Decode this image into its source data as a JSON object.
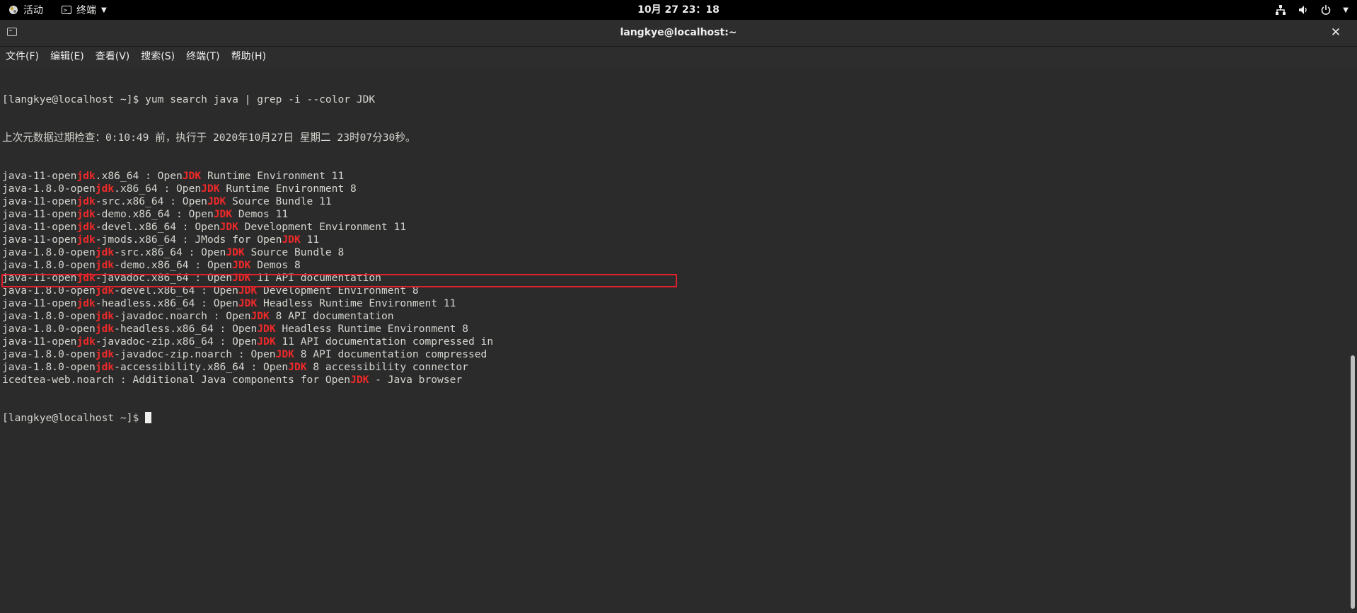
{
  "topbar": {
    "activities": "活动",
    "app_menu": "终端",
    "clock": "10月 27 23：18"
  },
  "window": {
    "title": "langkye@localhost:~",
    "close_glyph": "✕"
  },
  "menu": [
    "文件(F)",
    "编辑(E)",
    "查看(V)",
    "搜索(S)",
    "终端(T)",
    "帮助(H)"
  ],
  "terminal": {
    "prompt": "[langkye@localhost ~]$ ",
    "command": "yum search java | grep -i --color JDK",
    "metadata_line": "上次元数据过期检查：0:10:49 前，执行于 2020年10月27日 星期二 23时07分30秒。",
    "results": [
      {
        "pre": "java-11-open",
        "m1": "jdk",
        "mid": ".x86_64 : Open",
        "m2": "JDK",
        "post": " Runtime Environment 11"
      },
      {
        "pre": "java-1.8.0-open",
        "m1": "jdk",
        "mid": ".x86_64 : Open",
        "m2": "JDK",
        "post": " Runtime Environment 8"
      },
      {
        "pre": "java-11-open",
        "m1": "jdk",
        "mid": "-src.x86_64 : Open",
        "m2": "JDK",
        "post": " Source Bundle 11"
      },
      {
        "pre": "java-11-open",
        "m1": "jdk",
        "mid": "-demo.x86_64 : Open",
        "m2": "JDK",
        "post": " Demos 11"
      },
      {
        "pre": "java-11-open",
        "m1": "jdk",
        "mid": "-devel.x86_64 : Open",
        "m2": "JDK",
        "post": " Development Environment 11"
      },
      {
        "pre": "java-11-open",
        "m1": "jdk",
        "mid": "-jmods.x86_64 : JMods for Open",
        "m2": "JDK",
        "post": " 11"
      },
      {
        "pre": "java-1.8.0-open",
        "m1": "jdk",
        "mid": "-src.x86_64 : Open",
        "m2": "JDK",
        "post": " Source Bundle 8"
      },
      {
        "pre": "java-1.8.0-open",
        "m1": "jdk",
        "mid": "-demo.x86_64 : Open",
        "m2": "JDK",
        "post": " Demos 8"
      },
      {
        "pre": "java-11-open",
        "m1": "jdk",
        "mid": "-javadoc.x86_64 : Open",
        "m2": "JDK",
        "post": " 11 API documentation"
      },
      {
        "pre": "java-1.8.0-open",
        "m1": "jdk",
        "mid": "-devel.x86_64 : Open",
        "m2": "JDK",
        "post": " Development Environment 8"
      },
      {
        "pre": "java-11-open",
        "m1": "jdk",
        "mid": "-headless.x86_64 : Open",
        "m2": "JDK",
        "post": " Headless Runtime Environment 11"
      },
      {
        "pre": "java-1.8.0-open",
        "m1": "jdk",
        "mid": "-javadoc.noarch : Open",
        "m2": "JDK",
        "post": " 8 API documentation"
      },
      {
        "pre": "java-1.8.0-open",
        "m1": "jdk",
        "mid": "-headless.x86_64 : Open",
        "m2": "JDK",
        "post": " Headless Runtime Environment 8"
      },
      {
        "pre": "java-11-open",
        "m1": "jdk",
        "mid": "-javadoc-zip.x86_64 : Open",
        "m2": "JDK",
        "post": " 11 API documentation compressed in"
      },
      {
        "pre": "java-1.8.0-open",
        "m1": "jdk",
        "mid": "-javadoc-zip.noarch : Open",
        "m2": "JDK",
        "post": " 8 API documentation compressed"
      },
      {
        "pre": "java-1.8.0-open",
        "m1": "jdk",
        "mid": "-accessibility.x86_64 : Open",
        "m2": "JDK",
        "post": " 8 accessibility connector"
      },
      {
        "pre": "icedtea-web.noarch : Additional Java components for Open",
        "m1": "JDK",
        "mid": " - Java browser",
        "m2": "",
        "post": ""
      }
    ],
    "highlighted_result_index": 9
  },
  "colors": {
    "match": "#ef2929",
    "annotation_box": "#e0202a",
    "terminal_bg": "#2b2b2b",
    "terminal_fg": "#d3d7cf"
  }
}
